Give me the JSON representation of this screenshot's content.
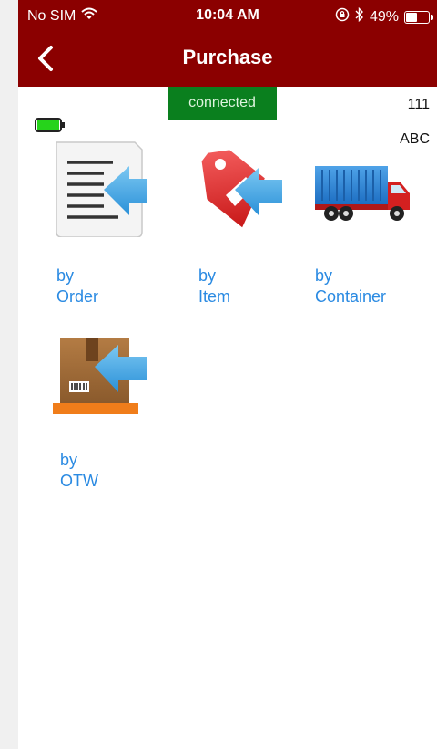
{
  "status_bar": {
    "carrier": "No SIM",
    "time": "10:04 AM",
    "battery_percent": "49%",
    "battery_level": 0.49
  },
  "navbar": {
    "title": "Purchase",
    "back_icon": "chevron-left-icon"
  },
  "connection": {
    "status_text": "connected",
    "color": "#0a7f1e"
  },
  "device": {
    "number": "111",
    "code": "ABC",
    "battery_level": 1.0
  },
  "menu": [
    {
      "label": "by Order",
      "icon": "document-arrow-icon"
    },
    {
      "label": "by Item",
      "icon": "tag-arrow-icon"
    },
    {
      "label": "by Container",
      "icon": "truck-icon"
    },
    {
      "label": "by OTW",
      "icon": "box-arrow-icon"
    }
  ],
  "colors": {
    "header": "#8b0000",
    "link": "#2a8ae2"
  }
}
